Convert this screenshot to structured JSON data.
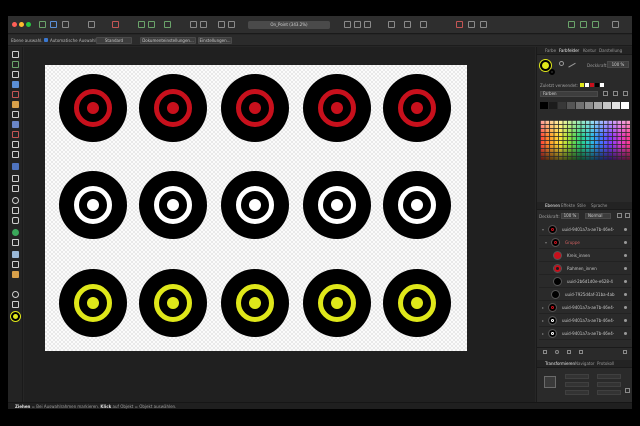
{
  "window": {
    "document_title": "On_Point (343.2%)"
  },
  "context_toolbar": {
    "select_all_label": "Ebene auswahl.",
    "auto_select_label": "Automatische Auswahl",
    "mode_value": "Standard",
    "doc_settings_label": "Dokumenteinstellungen...",
    "settings_label": "Einstellungen..."
  },
  "canvas": {
    "rows": [
      {
        "ring_color": "#c8101c",
        "dot_color": "#c8101c"
      },
      {
        "ring_color": "#ffffff",
        "dot_color": "#ffffff"
      },
      {
        "ring_color": "#dfe71a",
        "dot_color": "#dfe71a"
      }
    ],
    "columns": 5
  },
  "status_bar": {
    "prefix": "Ziehen",
    "middle": " = Bei Auswahlrahmen markieren. ",
    "klick": "Klick",
    "suffix": " auf Objekt = Objekt auswählen."
  },
  "color_panel": {
    "tabs": [
      "Farbe",
      "Farbfelder",
      "Kontur",
      "Darstellung"
    ],
    "active_tab": "Farbfelder",
    "opacity_label": "Deckkraft:",
    "opacity_value": "100 %",
    "recent_label": "Zuletzt verwendet:",
    "palette_name": "Farben"
  },
  "layers_panel": {
    "tabs": [
      "Ebenen",
      "Effekte",
      "Stile",
      "Sprache"
    ],
    "active_tab": "Ebenen",
    "opacity_label": "Deckkraft:",
    "opacity_value": "100 %",
    "blend_value": "Normal",
    "layers": [
      {
        "name": "uuid-9401a7a-ae7b-46e4-",
        "thumb": "red",
        "indent": 0,
        "expanded": true
      },
      {
        "name": "Gruppe",
        "thumb": "red",
        "indent": 1,
        "expanded": true
      },
      {
        "name": "Kreis_innen",
        "thumb": "reddot",
        "indent": 2
      },
      {
        "name": "Rahmen_innen",
        "thumb": "redring",
        "indent": 2
      },
      {
        "name": "uuid-2b6d1d0e-e628-4",
        "thumb": "black",
        "indent": 2
      },
      {
        "name": "uuid-7925d4af-31ba-4ab",
        "thumb": "black",
        "indent": 1
      },
      {
        "name": "uuid-9401a7a-ae7b-46e4-",
        "thumb": "red",
        "indent": 0
      },
      {
        "name": "uuid-9401a7a-ae7b-46e4-",
        "thumb": "white",
        "indent": 0
      },
      {
        "name": "uuid-9401a7a-ae7b-46e4-",
        "thumb": "white",
        "indent": 0
      }
    ]
  },
  "transform_panel": {
    "tabs": [
      "Transformieren",
      "Navigator",
      "Protokoll"
    ],
    "active_tab": "Transformieren"
  }
}
